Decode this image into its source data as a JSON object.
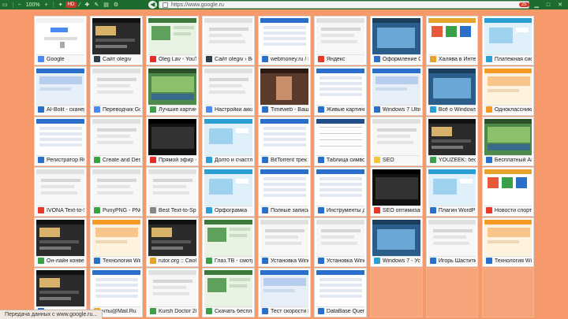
{
  "toolbar": {
    "zoom": "100%",
    "url": "https://www.google.ru",
    "back_symbol": "◀",
    "left_icons": [
      "tab-icon",
      "minus-icon",
      "plus-icon",
      "star-icon",
      "wand-icon",
      "puzzle-icon",
      "brush-icon",
      "doc-icon"
    ],
    "right_badge": "25",
    "right_icons": [
      "minimize-icon",
      "restore-icon",
      "close-icon"
    ]
  },
  "tiles": [
    {
      "label": "Google",
      "fav": "#4a8af4",
      "theme": "google"
    },
    {
      "label": "Сайт olegiv",
      "fav": "#2c3e50",
      "theme": "dark"
    },
    {
      "label": "Oleg Lav - YouTu",
      "fav": "#e52d27",
      "theme": "green"
    },
    {
      "label": "Сайт olegiv › Войт",
      "fav": "#2c3e50",
      "theme": "light"
    },
    {
      "label": "webmoney.ru / E",
      "fav": "#2a6fc9",
      "theme": "table"
    },
    {
      "label": "Яндекс",
      "fav": "#e8382a",
      "theme": "light"
    },
    {
      "label": "Оформление ОС",
      "fav": "#2a6fc9",
      "theme": "desktop"
    },
    {
      "label": "Халява в Интер",
      "fav": "#e8a12a",
      "theme": "colorful"
    },
    {
      "label": "Платежная сист",
      "fav": "#2a9fd6",
      "theme": "sky"
    },
    {
      "label": "AI-Bolit - сканер",
      "fav": "#2a6fc9",
      "theme": "blue"
    },
    {
      "label": "Переводчик Goo",
      "fav": "#4a8af4",
      "theme": "light"
    },
    {
      "label": "Лучшие картин",
      "fav": "#3aa04a",
      "theme": "nature"
    },
    {
      "label": "Настройки акка",
      "fav": "#4a8af4",
      "theme": "light"
    },
    {
      "label": "Timeweb - Ваш н",
      "fav": "#2a6fc9",
      "theme": "photo"
    },
    {
      "label": "Живые картинк",
      "fav": "#2a6fc9",
      "theme": "table"
    },
    {
      "label": "Windows 7 Ultim",
      "fav": "#2a6fc9",
      "theme": "blue"
    },
    {
      "label": "Всё о Windows 8",
      "fav": "#2a9fd6",
      "theme": "desktop"
    },
    {
      "label": "Одноклассники",
      "fav": "#f59a22",
      "theme": "orange"
    },
    {
      "label": "Регистратор R0",
      "fav": "#2a6fc9",
      "theme": "table"
    },
    {
      "label": "Create and Desig",
      "fav": "#3aa04a",
      "theme": "light"
    },
    {
      "label": "Прямой эфир -",
      "fav": "#e52d27",
      "theme": "black"
    },
    {
      "label": "Долго и счастл",
      "fav": "#2a9fd6",
      "theme": "sky"
    },
    {
      "label": "BitTorrent трек",
      "fav": "#2a6fc9",
      "theme": "table"
    },
    {
      "label": "Таблица символ",
      "fav": "#2a6fc9",
      "theme": "grid"
    },
    {
      "label": "SEO",
      "fav": "#f5c542",
      "theme": "light"
    },
    {
      "label": "YOUZEEK: бесп",
      "fav": "#3aa04a",
      "theme": "dark"
    },
    {
      "label": "Бесплатный Ант",
      "fav": "#2a6fc9",
      "theme": "nature"
    },
    {
      "label": "IVONA Text-to-Sp",
      "fav": "#e8382a",
      "theme": "light"
    },
    {
      "label": "PunyPNG - PNG c",
      "fav": "#3aa04a",
      "theme": "light"
    },
    {
      "label": "Best Text-to-Speech",
      "fav": "#888888",
      "theme": "light"
    },
    {
      "label": "Орфограмка",
      "fav": "#2a9fd6",
      "theme": "sky"
    },
    {
      "label": "Полные записи",
      "fav": "#2a6fc9",
      "theme": "table"
    },
    {
      "label": "Инструменты д",
      "fav": "#2a6fc9",
      "theme": "table"
    },
    {
      "label": "SEO оптимизац",
      "fav": "#e8382a",
      "theme": "black"
    },
    {
      "label": "Плагин WordPress",
      "fav": "#2a6fc9",
      "theme": "sky"
    },
    {
      "label": "Новости спорта",
      "fav": "#e8382a",
      "theme": "colorful"
    },
    {
      "label": "Он-лайн конвер",
      "fav": "#3aa04a",
      "theme": "dark"
    },
    {
      "label": "Технология Win",
      "fav": "#2a6fc9",
      "theme": "orange"
    },
    {
      "label": "rutor.org :: Своб",
      "fav": "#e8a12a",
      "theme": "dark"
    },
    {
      "label": "Глаз.ТВ - смотр",
      "fav": "#3aa04a",
      "theme": "green"
    },
    {
      "label": "Установка Wind",
      "fav": "#2a6fc9",
      "theme": "light"
    },
    {
      "label": "Установка Wind",
      "fav": "#2a6fc9",
      "theme": "light"
    },
    {
      "label": "Windows 7 - Уст",
      "fav": "#2a9fd6",
      "theme": "desktop"
    },
    {
      "label": "Игорь Шаститк",
      "fav": "#2a6fc9",
      "theme": "light"
    },
    {
      "label": "Технология Win",
      "fav": "#2a6fc9",
      "theme": "orange"
    },
    {
      "label": "",
      "fav": "#2a6fc9",
      "theme": "dark"
    },
    {
      "label": "чты@Mail.Ru",
      "fav": "#f5a623",
      "theme": "table"
    },
    {
      "label": "Kursh Doctor 20",
      "fav": "#3aa04a",
      "theme": "light"
    },
    {
      "label": "Скачать бесплa",
      "fav": "#3aa04a",
      "theme": "green"
    },
    {
      "label": "Тест скорости и",
      "fav": "#2a6fc9",
      "theme": "blue"
    },
    {
      "label": "DataBase Query",
      "fav": "#2a6fc9",
      "theme": "table"
    },
    {
      "label": "",
      "fav": "",
      "theme": "empty"
    },
    {
      "label": "",
      "fav": "",
      "theme": "empty"
    },
    {
      "label": "",
      "fav": "",
      "theme": "empty"
    }
  ],
  "status": {
    "text": "Передача данных с www.google.ru..."
  }
}
